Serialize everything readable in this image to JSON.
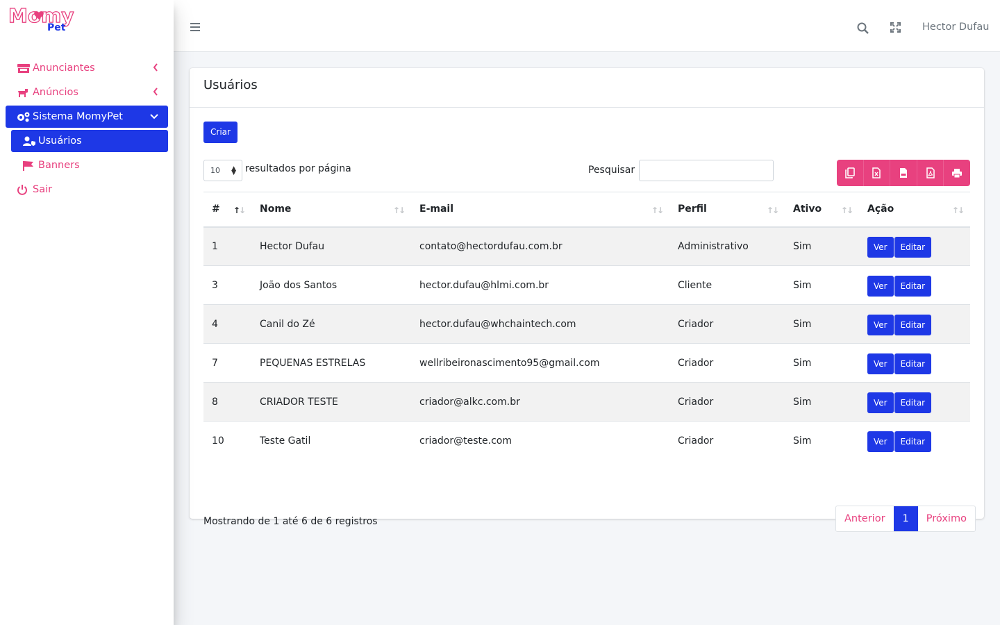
{
  "brand": {
    "line1": "Momy",
    "line2": "Pet"
  },
  "colors": {
    "primary": "#1e38e6",
    "accent": "#e8417f"
  },
  "sidebar": {
    "items": [
      {
        "label": "Anunciantes",
        "icon": "store-icon"
      },
      {
        "label": "Anúncios",
        "icon": "dog-icon"
      },
      {
        "label": "Sistema MomyPet",
        "icon": "cogs-icon"
      },
      {
        "label": "Usuários",
        "icon": "user-shield-icon"
      },
      {
        "label": "Banners",
        "icon": "flag-icon"
      },
      {
        "label": "Sair",
        "icon": "power-icon"
      }
    ]
  },
  "topbar": {
    "user": "Hector Dufau"
  },
  "card": {
    "title": "Usuários"
  },
  "toolbar": {
    "create_label": "Criar",
    "page_length": "10",
    "page_length_label": "resultados por página",
    "search_label": "Pesquisar",
    "search_value": ""
  },
  "table": {
    "headers": [
      "#",
      "Nome",
      "E-mail",
      "Perfil",
      "Ativo",
      "Ação"
    ],
    "view_label": "Ver",
    "edit_label": "Editar",
    "rows": [
      {
        "id": "1",
        "name": "Hector Dufau",
        "email": "contato@hectordufau.com.br",
        "profile": "Administrativo",
        "active": "Sim"
      },
      {
        "id": "3",
        "name": "João dos Santos",
        "email": "hector.dufau@hlmi.com.br",
        "profile": "Cliente",
        "active": "Sim"
      },
      {
        "id": "4",
        "name": "Canil do Zé",
        "email": "hector.dufau@whchaintech.com",
        "profile": "Criador",
        "active": "Sim"
      },
      {
        "id": "7",
        "name": "PEQUENAS ESTRELAS",
        "email": "wellribeironascimento95@gmail.com",
        "profile": "Criador",
        "active": "Sim"
      },
      {
        "id": "8",
        "name": "CRIADOR TESTE",
        "email": "criador@alkc.com.br",
        "profile": "Criador",
        "active": "Sim"
      },
      {
        "id": "10",
        "name": "Teste Gatil",
        "email": "criador@teste.com",
        "profile": "Criador",
        "active": "Sim"
      }
    ]
  },
  "footer": {
    "info": "Mostrando de 1 até 6 de 6 registros",
    "prev": "Anterior",
    "current_page": "1",
    "next": "Próximo"
  }
}
